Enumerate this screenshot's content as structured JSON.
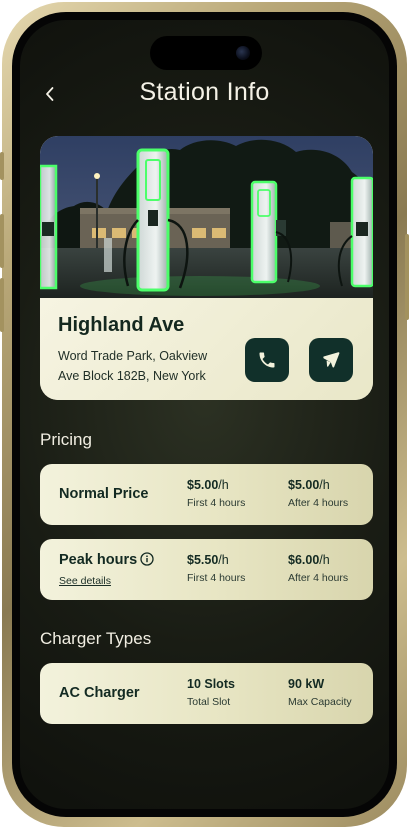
{
  "header": {
    "title": "Station Info"
  },
  "station": {
    "name": "Highland Ave",
    "address": "Word Trade Park, Oakview Ave Block 182B, New York"
  },
  "pricing": {
    "section_title": "Pricing",
    "normal": {
      "label": "Normal Price",
      "first_value": "$5.00",
      "first_unit": "/h",
      "first_note": "First 4 hours",
      "after_value": "$5.00",
      "after_unit": "/h",
      "after_note": "After 4 hours"
    },
    "peak": {
      "label": "Peak hours",
      "link": "See details",
      "first_value": "$5.50",
      "first_unit": "/h",
      "first_note": "First 4 hours",
      "after_value": "$6.00",
      "after_unit": "/h",
      "after_note": "After 4 hours"
    }
  },
  "chargers": {
    "section_title": "Charger Types",
    "ac": {
      "label": "AC Charger",
      "slots_value": "10 Slots",
      "slots_note": "Total Slot",
      "capacity_value": "90 kW",
      "capacity_note": "Max Capacity"
    }
  },
  "icons": {
    "back": "chevron-left-icon",
    "call": "phone-icon",
    "directions": "directions-icon",
    "info": "info-icon"
  },
  "colors": {
    "card_dark": "#11302a",
    "card_light": "#efeeda",
    "accent_glow": "#4cff6a"
  }
}
